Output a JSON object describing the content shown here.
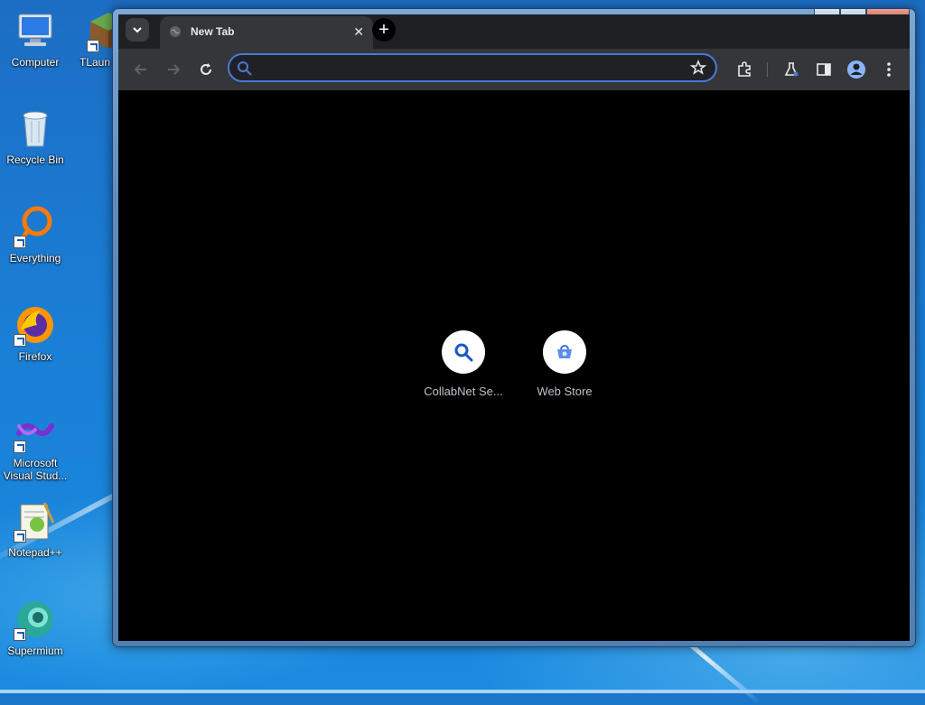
{
  "desktop": {
    "icons": [
      {
        "label": "Computer"
      },
      {
        "label": "TLaun"
      },
      {
        "label": "Recycle Bin"
      },
      {
        "label": "Everything"
      },
      {
        "label": "Firefox"
      },
      {
        "label": "Microsoft Visual Stud..."
      },
      {
        "label": "Notepad++"
      },
      {
        "label": "Supermium"
      }
    ]
  },
  "window": {
    "caption": {
      "minimize": "—",
      "maximize": "□",
      "close": "✕"
    }
  },
  "browser": {
    "tabs": [
      {
        "title": "New Tab",
        "close": "✕",
        "icon": "globe-icon"
      }
    ],
    "new_tab_symbol": "+",
    "tab_search_symbol": "⌄",
    "omnibox": {
      "value": "",
      "placeholder": ""
    },
    "toolbar_icons": [
      "back-icon",
      "forward-icon",
      "reload-icon",
      "bookmark-star-icon",
      "extensions-icon",
      "labs-icon",
      "side-panel-icon",
      "profile-icon",
      "menu-icon"
    ],
    "shortcuts": [
      {
        "label": "CollabNet Se...",
        "icon": "search-icon"
      },
      {
        "label": "Web Store",
        "icon": "web-store-icon"
      }
    ]
  },
  "colors": {
    "accent": "#4a78d6",
    "page_background": "#000000",
    "toolbar": "#35363a",
    "tab_strip": "#1f2023"
  }
}
